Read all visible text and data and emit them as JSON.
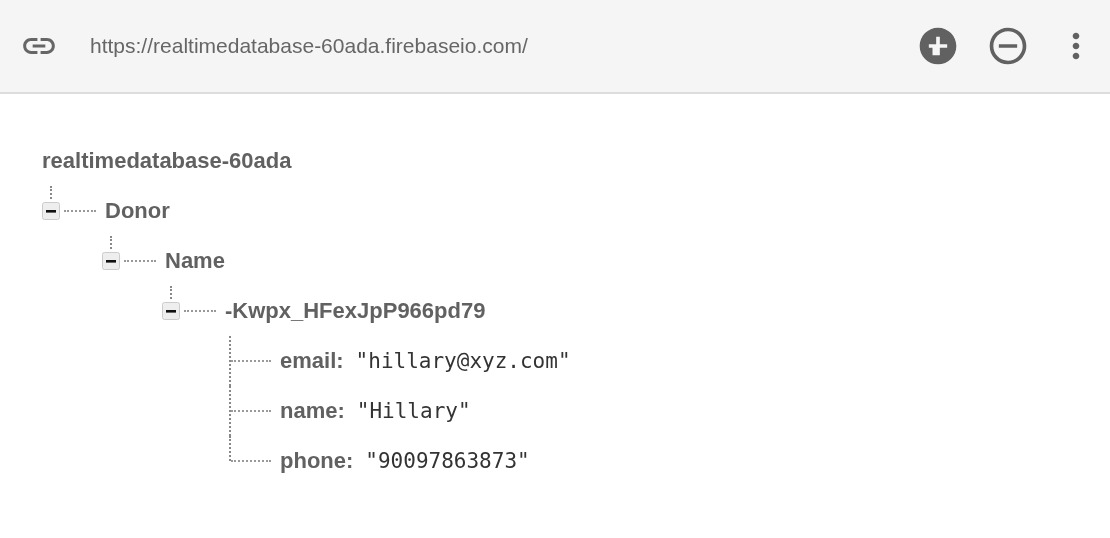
{
  "toolbar": {
    "url": "https://realtimedatabase-60ada.firebaseio.com/"
  },
  "tree": {
    "root": "realtimedatabase-60ada",
    "children": [
      {
        "key": "Donor",
        "expanded": true,
        "children": [
          {
            "key": "Name",
            "expanded": true,
            "children": [
              {
                "key": "-Kwpx_HFexJpP966pd79",
                "expanded": true,
                "children": [
                  {
                    "key": "email:",
                    "value": "\"hillary@xyz.com\""
                  },
                  {
                    "key": "name:",
                    "value": "\"Hillary\""
                  },
                  {
                    "key": "phone:",
                    "value": "\"90097863873\""
                  }
                ]
              }
            ]
          }
        ]
      }
    ]
  }
}
